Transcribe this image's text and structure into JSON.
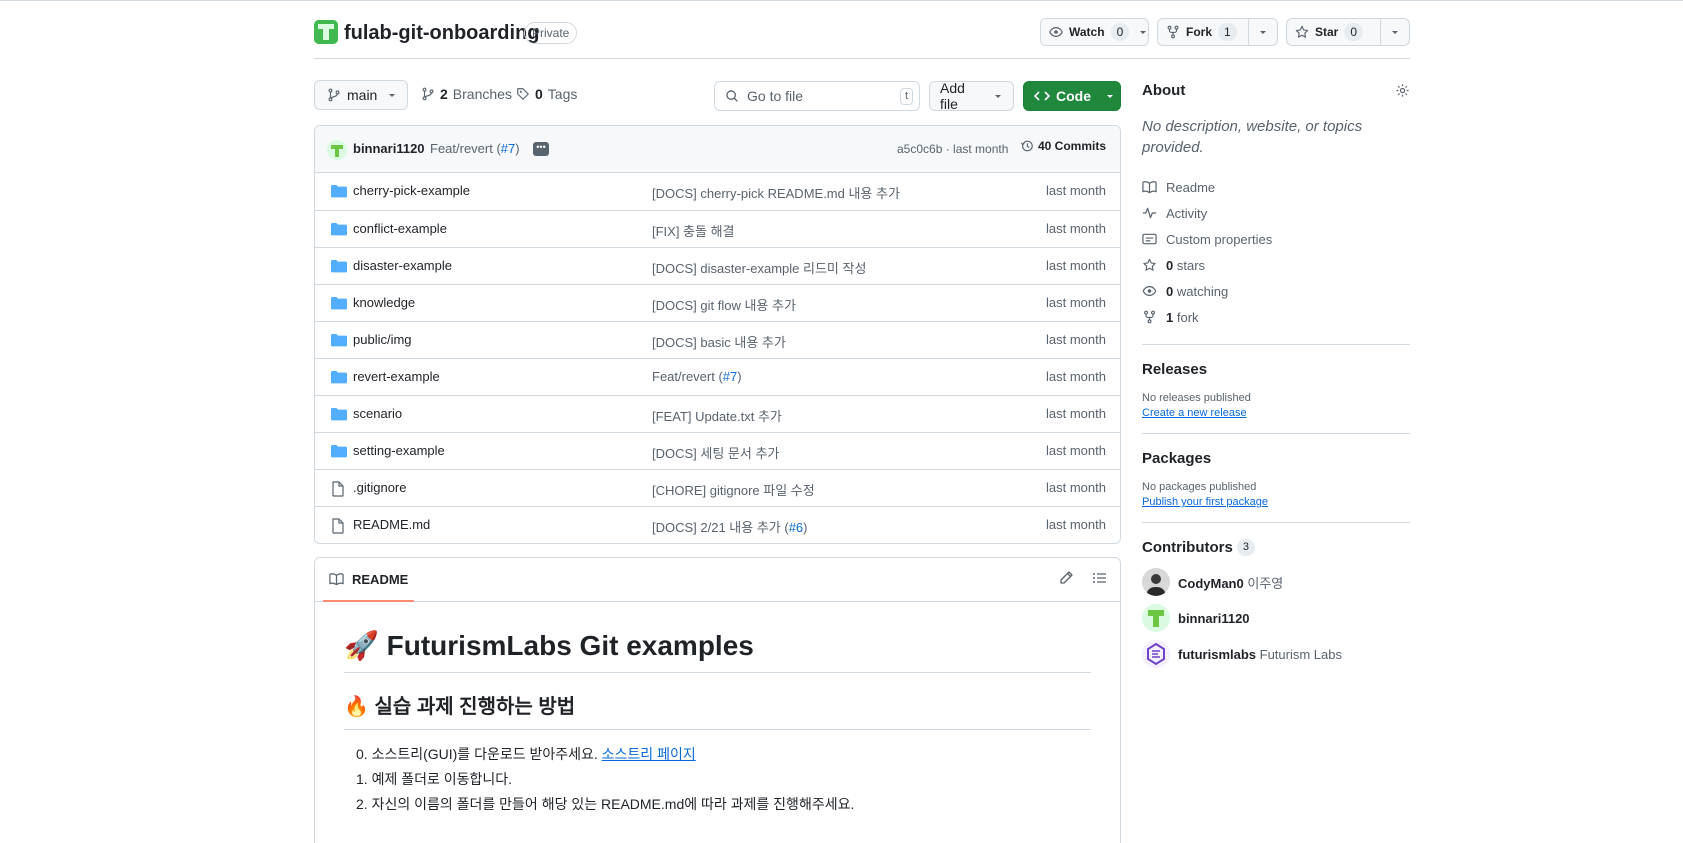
{
  "repo": {
    "name": "fulab-git-onboarding",
    "visibility": "Private",
    "watch_label": "Watch",
    "watch_count": "0",
    "fork_label": "Fork",
    "fork_count": "1",
    "star_label": "Star",
    "star_count": "0"
  },
  "toolbar": {
    "branch": "main",
    "branches_count": "2",
    "branches_label": "Branches",
    "tags_count": "0",
    "tags_label": "Tags",
    "search_placeholder": "Go to file",
    "search_shortcut": "t",
    "add_file_label": "Add file",
    "code_label": "Code"
  },
  "latest_commit": {
    "author": "binnari1120",
    "message_prefix": "Feat/revert (",
    "pr_link": "#7",
    "message_suffix": ")",
    "sha_date": "a5c0c6b · last month",
    "commits_count": "40 Commits"
  },
  "files": [
    {
      "type": "dir",
      "name": "cherry-pick-example",
      "message": "[DOCS] cherry-pick README.md 내용 추가",
      "pr": "",
      "date": "last month"
    },
    {
      "type": "dir",
      "name": "conflict-example",
      "message": "[FIX] 충돌 해결",
      "pr": "",
      "date": "last month"
    },
    {
      "type": "dir",
      "name": "disaster-example",
      "message": "[DOCS] disaster-example 리드미 작성",
      "pr": "",
      "date": "last month"
    },
    {
      "type": "dir",
      "name": "knowledge",
      "message": "[DOCS] git flow 내용 추가",
      "pr": "",
      "date": "last month"
    },
    {
      "type": "dir",
      "name": "public/img",
      "message": "[DOCS] basic 내용 추가",
      "pr": "",
      "date": "last month"
    },
    {
      "type": "dir",
      "name": "revert-example",
      "message": "Feat/revert (",
      "pr": "#7",
      "date": "last month"
    },
    {
      "type": "dir",
      "name": "scenario",
      "message": "[FEAT] Update.txt 추가",
      "pr": "",
      "date": "last month"
    },
    {
      "type": "dir",
      "name": "setting-example",
      "message": "[DOCS] 세팅 문서 추가",
      "pr": "",
      "date": "last month"
    },
    {
      "type": "file",
      "name": ".gitignore",
      "message": "[CHORE] gitignore 파일 수정",
      "pr": "",
      "date": "last month"
    },
    {
      "type": "file",
      "name": "README.md",
      "message": "[DOCS] 2/21 내용 추가 (",
      "pr": "#6",
      "date": "last month"
    }
  ],
  "readme": {
    "tab_label": "README",
    "h1": "🚀 FuturismLabs Git examples",
    "h2": "🔥 실습 과제 진행하는 방법",
    "items": [
      {
        "num": "0.",
        "text": "소스트리(GUI)를 다운로드 받아주세요.",
        "link": "소스트리 페이지"
      },
      {
        "num": "1.",
        "text": "예제 폴더로 이동합니다.",
        "link": ""
      },
      {
        "num": "2.",
        "text": "자신의 이름의 폴더를 만들어 해당 있는 README.md에 따라 과제를 진행해주세요.",
        "link": ""
      }
    ]
  },
  "about": {
    "title": "About",
    "description": "No description, website, or topics provided.",
    "readme": "Readme",
    "activity": "Activity",
    "custom_properties": "Custom properties",
    "stars_count": "0",
    "stars_label": "stars",
    "watching_count": "0",
    "watching_label": "watching",
    "forks_count": "1",
    "forks_label": "fork"
  },
  "releases": {
    "title": "Releases",
    "empty": "No releases published",
    "link": "Create a new release"
  },
  "packages": {
    "title": "Packages",
    "empty": "No packages published",
    "link": "Publish your first package"
  },
  "contributors": {
    "title": "Contributors",
    "count": "3",
    "list": [
      {
        "login": "CodyMan0",
        "name": "이주영"
      },
      {
        "login": "binnari1120",
        "name": ""
      },
      {
        "login": "futurismlabs",
        "name": "Futurism Labs"
      }
    ]
  },
  "colors": {
    "accent_link": "#0969da",
    "code_button": "#1f883d",
    "folder_icon": "#54aeff",
    "tab_underline": "#fd8c73"
  }
}
